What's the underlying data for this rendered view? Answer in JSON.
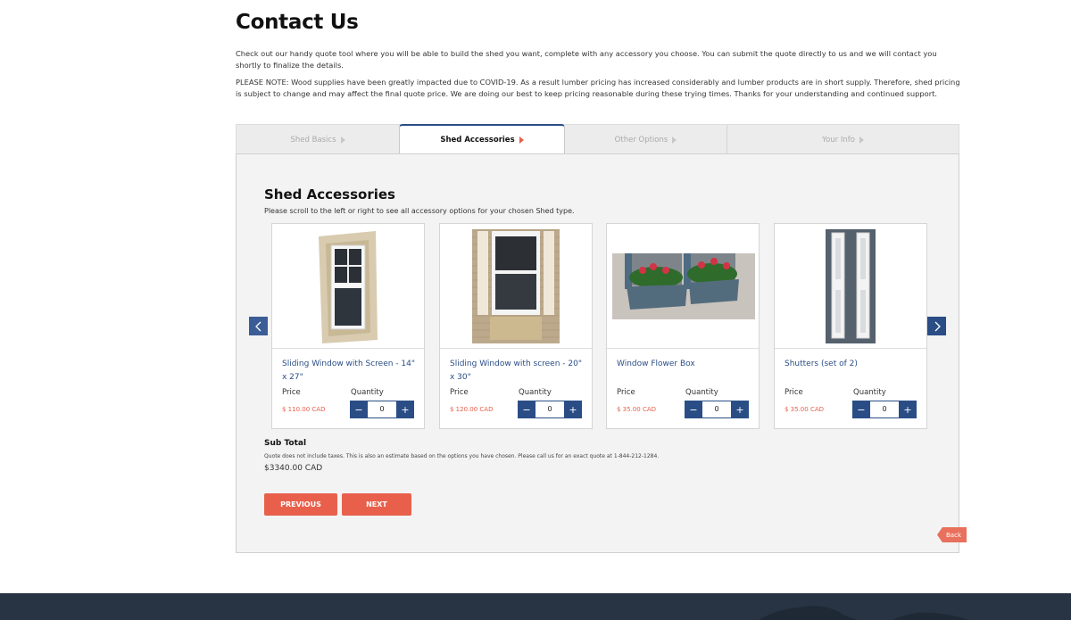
{
  "page": {
    "title": "Contact Us",
    "intro": "Check out our handy quote tool where you will be able to build the shed you want, complete with any accessory you choose. You can submit the quote directly to us and we will contact you shortly to finalize the details.",
    "notice": "PLEASE NOTE: Wood supplies have been greatly impacted due to COVID-19. As a result lumber pricing has increased considerably and lumber products are in short supply. Therefore, shed pricing is subject to change and may affect the final quote price. We are doing our best to keep pricing reasonable during these trying times. Thanks for your understanding and continued support."
  },
  "tabs": [
    {
      "label": "Shed Basics",
      "active": false
    },
    {
      "label": "Shed Accessories",
      "active": true
    },
    {
      "label": "Other Options",
      "active": false
    },
    {
      "label": "Your Info",
      "active": false
    }
  ],
  "section": {
    "title": "Shed Accessories",
    "subtitle": "Please scroll to the left or right to see all accessory options for your chosen Shed type."
  },
  "labels": {
    "price": "Price",
    "quantity": "Quantity",
    "minus": "−",
    "plus": "+"
  },
  "products": [
    {
      "name": "Sliding Window with Screen - 14\" x 27\"",
      "price": "$ 110.00 CAD",
      "quantity": "0",
      "image_icon": "sliding-window-image"
    },
    {
      "name": "Sliding Window with screen - 20\" x 30\"",
      "price": "$ 120.00 CAD",
      "quantity": "0",
      "image_icon": "sliding-window-image"
    },
    {
      "name": "Window Flower Box",
      "price": "$ 35.00 CAD",
      "quantity": "0",
      "image_icon": "flower-box-image"
    },
    {
      "name": "Shutters (set of 2)",
      "price": "$ 35.00 CAD",
      "quantity": "0",
      "image_icon": "shutters-image"
    }
  ],
  "subtotal": {
    "title": "Sub Total",
    "note": "Quote does not include taxes. This is also an estimate based on the options you have chosen. Please call us for an exact quote at 1-844-212-1284.",
    "value": "$3340.00 CAD"
  },
  "actions": {
    "previous": "PREVIOUS",
    "next": "NEXT",
    "back": "Back"
  },
  "colors": {
    "primary": "#2a4d86",
    "accent": "#e8604c",
    "footer": "#283444"
  }
}
